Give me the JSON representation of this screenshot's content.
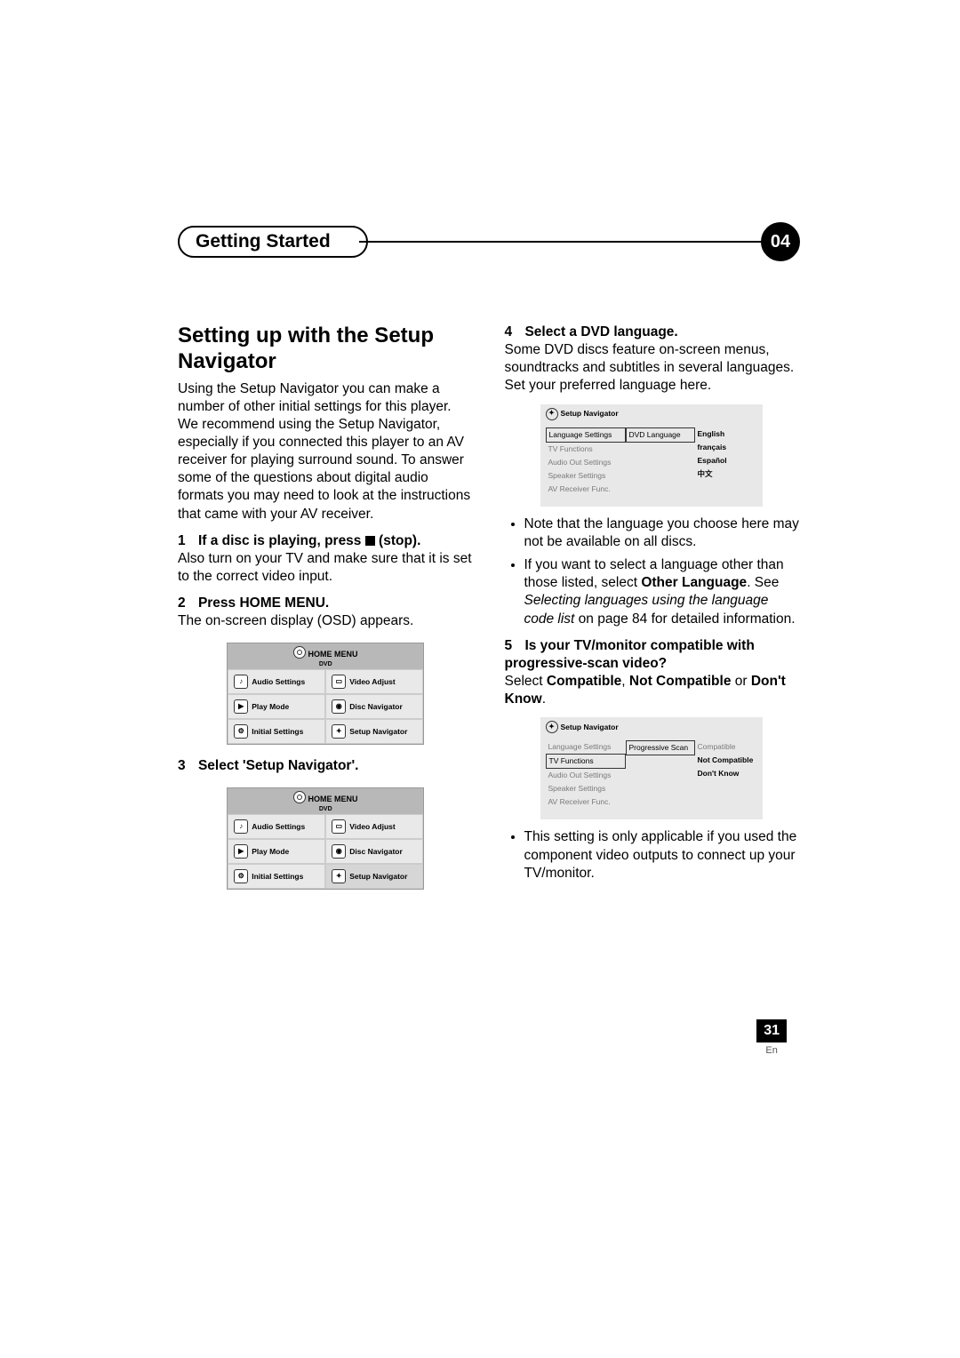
{
  "header": {
    "title": "Getting Started",
    "chapter": "04"
  },
  "left": {
    "heading": "Setting up with the Setup Navigator",
    "intro": "Using the Setup Navigator you can make a number of other initial settings for this player. We recommend using the Setup Navigator, especially if you connected this player to an AV receiver for playing surround sound. To answer some of the questions about digital audio formats you may need to look at the instructions that came with your AV receiver.",
    "step1": {
      "num": "1",
      "title_before": "If a disc is playing, press ",
      "title_after": " (stop).",
      "text": "Also turn on your TV and make sure that it is set to the correct video input."
    },
    "step2": {
      "num": "2",
      "title": "Press HOME MENU.",
      "text": "The on-screen display (OSD) appears."
    },
    "step3": {
      "num": "3",
      "title": "Select 'Setup Navigator'."
    },
    "home_menu": {
      "title": "HOME MENU",
      "subtitle": "DVD",
      "cells": [
        "Audio Settings",
        "Video Adjust",
        "Play Mode",
        "Disc Navigator",
        "Initial Settings",
        "Setup Navigator"
      ]
    }
  },
  "right": {
    "step4": {
      "num": "4",
      "title": "Select a DVD language.",
      "text": "Some DVD discs feature on-screen menus, soundtracks and subtitles in several languages. Set your preferred language here."
    },
    "nav1": {
      "title": "Setup Navigator",
      "left_items": [
        "Language Settings",
        "TV Functions",
        "Audio Out Settings",
        "Speaker Settings",
        "AV Receiver Func."
      ],
      "mid_item": "DVD Language",
      "right_items": [
        "English",
        "français",
        "Español",
        "中文"
      ]
    },
    "bullet1": "Note that the language you choose here may not be available on all discs.",
    "bullet2_a": "If you want to select a language other than those listed, select ",
    "bullet2_b": "Other Language",
    "bullet2_c": ". See ",
    "bullet2_d": "Selecting languages using the language code list",
    "bullet2_e": " on page 84 for detailed information.",
    "step5": {
      "num": "5",
      "title": "Is your TV/monitor compatible with progressive-scan video?",
      "text_a": "Select ",
      "text_b": "Compatible",
      "text_c": ", ",
      "text_d": "Not Compatible",
      "text_e": " or ",
      "text_f": "Don't Know",
      "text_g": "."
    },
    "nav2": {
      "title": "Setup Navigator",
      "left_items": [
        "Language Settings",
        "TV Functions",
        "Audio Out Settings",
        "Speaker Settings",
        "AV Receiver Func."
      ],
      "mid_item": "Progressive Scan",
      "right_items": [
        "Compatible",
        "Not Compatible",
        "Don't Know"
      ]
    },
    "bullet3": "This setting is only applicable if you used the component video outputs to connect up your TV/monitor."
  },
  "footer": {
    "page": "31",
    "lang": "En"
  }
}
